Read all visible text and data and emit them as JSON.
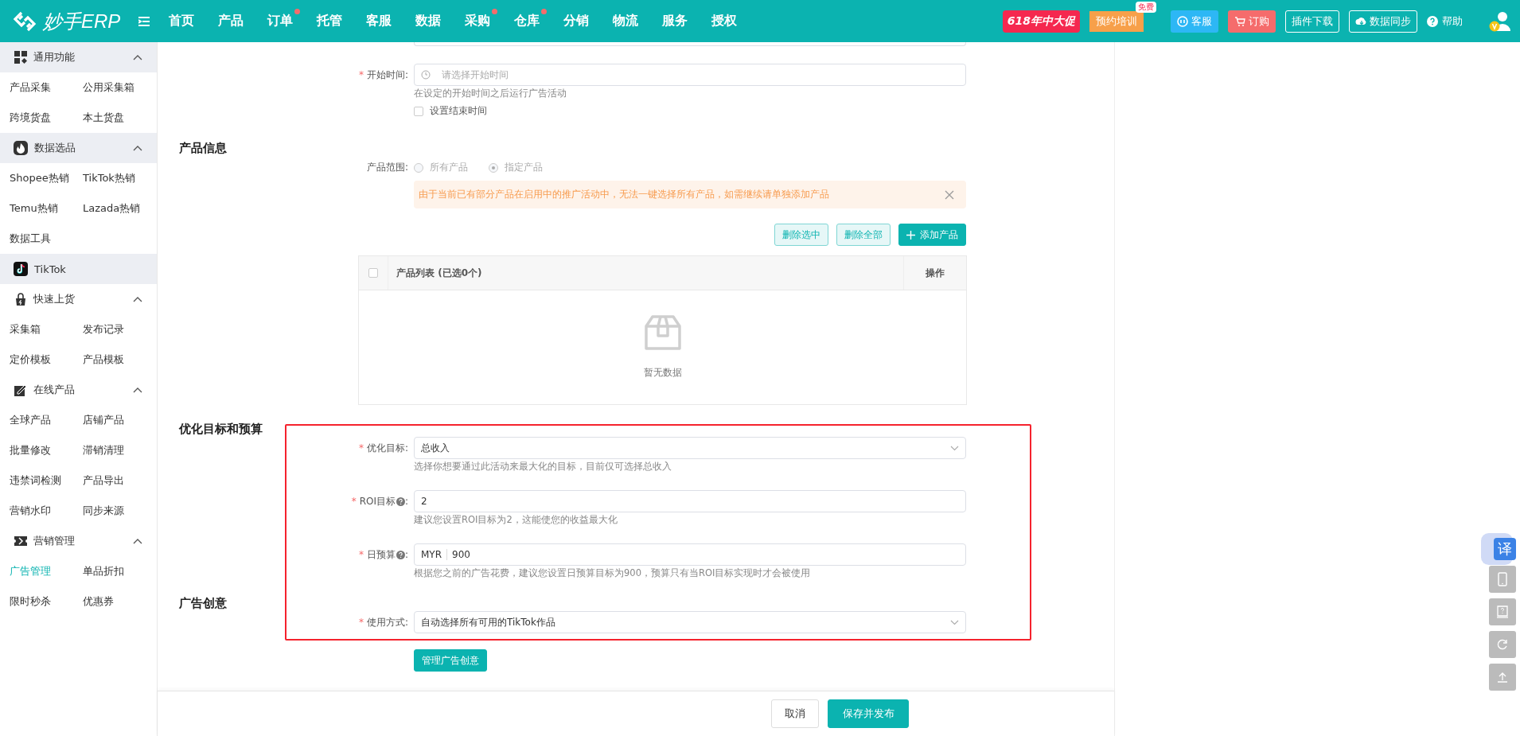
{
  "header": {
    "logo": "妙手ERP",
    "nav": [
      {
        "label": "首页",
        "dot": false
      },
      {
        "label": "产品",
        "dot": false
      },
      {
        "label": "订单",
        "dot": true
      },
      {
        "label": "托管",
        "dot": false
      },
      {
        "label": "客服",
        "dot": false
      },
      {
        "label": "数据",
        "dot": false
      },
      {
        "label": "采购",
        "dot": true
      },
      {
        "label": "仓库",
        "dot": true
      },
      {
        "label": "分销",
        "dot": false
      },
      {
        "label": "物流",
        "dot": false
      },
      {
        "label": "服务",
        "dot": false
      },
      {
        "label": "授权",
        "dot": false
      }
    ],
    "promo": "618年中大促",
    "training": {
      "label": "预约培训",
      "badge": "免费"
    },
    "actions": [
      {
        "label": "客服",
        "kind": "service"
      },
      {
        "label": "订购",
        "kind": "order"
      },
      {
        "label": "插件下载",
        "kind": "outline"
      },
      {
        "label": "数据同步",
        "kind": "sync"
      }
    ],
    "help": "帮助"
  },
  "sidebar": {
    "groups": [
      {
        "title": "通用功能",
        "kind": "group",
        "shaded": true,
        "expanded": true,
        "items": [
          {
            "label": "产品采集",
            "selected": false
          },
          {
            "label": "公用采集箱",
            "selected": false
          },
          {
            "label": "跨境货盘",
            "selected": false
          },
          {
            "label": "本土货盘",
            "selected": false
          }
        ]
      },
      {
        "title": "数据选品",
        "kind": "group",
        "shaded": true,
        "expanded": true,
        "items": [
          {
            "label": "Shopee热销",
            "selected": false
          },
          {
            "label": "TikTok热销",
            "selected": false
          },
          {
            "label": "Temu热销",
            "selected": false
          },
          {
            "label": "Lazada热销",
            "selected": false
          },
          {
            "label": "数据工具",
            "selected": false
          }
        ]
      },
      {
        "title": "TikTok",
        "kind": "link",
        "shaded": true
      },
      {
        "title": "快速上货",
        "kind": "group",
        "shaded": false,
        "expanded": true,
        "items": [
          {
            "label": "采集箱",
            "selected": false
          },
          {
            "label": "发布记录",
            "selected": false
          },
          {
            "label": "定价模板",
            "selected": false
          },
          {
            "label": "产品模板",
            "selected": false
          }
        ]
      },
      {
        "title": "在线产品",
        "kind": "group",
        "shaded": false,
        "expanded": true,
        "items": [
          {
            "label": "全球产品",
            "selected": false
          },
          {
            "label": "店铺产品",
            "selected": false
          },
          {
            "label": "批量修改",
            "selected": false
          },
          {
            "label": "滞销清理",
            "selected": false
          },
          {
            "label": "违禁词检测",
            "selected": false
          },
          {
            "label": "产品导出",
            "selected": false
          },
          {
            "label": "营销水印",
            "selected": false
          },
          {
            "label": "同步来源",
            "selected": false
          }
        ]
      },
      {
        "title": "营销管理",
        "kind": "group",
        "shaded": false,
        "expanded": true,
        "items": [
          {
            "label": "广告管理",
            "selected": true
          },
          {
            "label": "单品折扣",
            "selected": false
          },
          {
            "label": "限时秒杀",
            "selected": false
          },
          {
            "label": "优惠券",
            "selected": false
          }
        ]
      }
    ]
  },
  "form": {
    "start_time": {
      "asterisk": "*",
      "label": "开始时间",
      "colon": ":",
      "placeholder": "请选择开始时间",
      "hint": "在设定的开始时间之后运行广告活动",
      "end_time": {
        "label": "设置结束时间",
        "checked": false
      }
    },
    "product_info": {
      "title": "产品信息",
      "scope": {
        "label": "产品范围",
        "colon": ":",
        "options": [
          {
            "label": "所有产品",
            "selected": false,
            "disabled": true
          },
          {
            "label": "指定产品",
            "selected": true,
            "disabled": true
          }
        ]
      },
      "alert": "由于当前已有部分产品在启用中的推广活动中，无法一键选择所有产品，如需继续请单独添加产品",
      "buttons": [
        {
          "label": "删除选中",
          "kind": "light"
        },
        {
          "label": "删除全部",
          "kind": "light"
        },
        {
          "label": "添加产品",
          "kind": "primary"
        }
      ],
      "table": {
        "select_all": {
          "checked": false
        },
        "columns": [
          "产品列表 (已选0个)",
          "操作"
        ],
        "empty_text": "暂无数据"
      }
    },
    "goal_budget": {
      "title": "优化目标和预算",
      "fields": [
        {
          "kind": "select",
          "asterisk": "*",
          "label": "优化目标",
          "colon": ":",
          "help": false,
          "value": "总收入",
          "hint": "选择你想要通过此活动来最大化的目标，目前仅可选择总收入"
        },
        {
          "kind": "input",
          "asterisk": "*",
          "label": "ROI目标",
          "colon": ":",
          "help": true,
          "value": "2",
          "hint": "建议您设置ROI目标为2，这能使您的收益最大化"
        },
        {
          "kind": "currency",
          "asterisk": "*",
          "label": "日预算",
          "colon": ":",
          "help": true,
          "prefix": "MYR",
          "value": "900",
          "hint": "根据您之前的广告花费，建议您设置日预算目标为900，预算只有当ROI目标实现时才会被使用"
        }
      ]
    },
    "creative": {
      "title": "广告创意",
      "fields": [
        {
          "kind": "select",
          "asterisk": "*",
          "label": "使用方式",
          "colon": ":",
          "help": false,
          "value": "自动选择所有可用的TikTok作品"
        }
      ],
      "button": "管理广告创意"
    }
  },
  "footer": {
    "buttons": [
      {
        "label": "取消",
        "kind": "default"
      },
      {
        "label": "保存并发布",
        "kind": "primary"
      }
    ]
  },
  "side_tools": {
    "translate": "译"
  }
}
